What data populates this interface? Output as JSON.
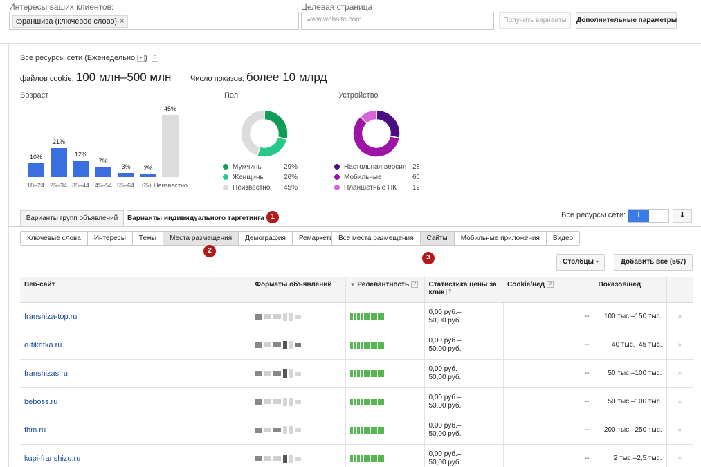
{
  "form": {
    "interests_label": "Интересы ваших клиентов:",
    "keyword_chip": "франшиза (ключевое слово)",
    "chip_remove": "×",
    "landing_label": "Целевая страница",
    "landing_placeholder": "www.website.com",
    "get_variants_btn": "Получить варианты",
    "advanced_btn": "Дополнительные параметры"
  },
  "summary": {
    "network_title": "Все ресурсы сети (Еженедельно",
    "network_title_close": ")",
    "cookies_label": "файлов cookie:",
    "cookies_value": "100 млн–500 млн",
    "impressions_label": "Число показов:",
    "impressions_value": "более 10 млрд",
    "help": "?",
    "dropdown": "▾"
  },
  "age": {
    "title": "Возраст",
    "bars": [
      {
        "label": "18–24",
        "value": "10%",
        "pct": 10
      },
      {
        "label": "25–34",
        "value": "21%",
        "pct": 21
      },
      {
        "label": "35–44",
        "value": "12%",
        "pct": 12
      },
      {
        "label": "45–54",
        "value": "7%",
        "pct": 7
      },
      {
        "label": "55–64",
        "value": "3%",
        "pct": 3
      },
      {
        "label": "65+",
        "value": "2%",
        "pct": 2
      },
      {
        "label": "Неизвестно",
        "value": "45%",
        "pct": 45
      }
    ]
  },
  "gender": {
    "title": "Пол",
    "items": [
      {
        "label": "Мужчины",
        "value": "29%",
        "color": "#0f9d58"
      },
      {
        "label": "Женщины",
        "value": "26%",
        "color": "#27c98a"
      },
      {
        "label": "Неизвестно",
        "value": "45%",
        "color": "#dcdcdc"
      }
    ]
  },
  "device": {
    "title": "Устройство",
    "items": [
      {
        "label": "Настольная версия",
        "value": "28",
        "color": "#4a0f80"
      },
      {
        "label": "Мобильные",
        "value": "60",
        "color": "#9c15a6"
      },
      {
        "label": "Планшетные ПК",
        "value": "12",
        "color": "#d665d8"
      }
    ]
  },
  "tabs": {
    "ad_groups": "Варианты групп объявлений",
    "individual": "Варианты индивидуального таргетинга",
    "badge1": "1",
    "badge2": "2",
    "badge3": "3",
    "all_network_label": "Все ресурсы сети:",
    "toggle_on": "I",
    "download_icon": "⬇"
  },
  "subtabs": [
    "Ключевые слова",
    "Интересы",
    "Темы",
    "Места размещения",
    "Демография",
    "Ремаркетинг"
  ],
  "placement_tabs": [
    "Все места размещения",
    "Сайты",
    "Мобильные приложения",
    "Видео"
  ],
  "actions": {
    "columns_btn": "Столбцы",
    "columns_caret": "▾",
    "add_all_btn": "Добавить все (567)"
  },
  "table": {
    "headers": {
      "site": "Веб-сайт",
      "formats": "Форматы объявлений",
      "relevance": "Релевантность",
      "sort_icon": "▼",
      "cpc": "Статистика цены за клик",
      "cookies": "Cookie/нед",
      "impressions": "Показов/нед"
    },
    "rows": [
      {
        "site": "franshiza-top.ru",
        "price1": "0,00 руб.–",
        "price2": "50,00 руб.",
        "cookies": "--",
        "impressions": "100 тыс.–150 тыс.",
        "chev": "»",
        "img_on": false,
        "mob_on": false,
        "vid_on": false
      },
      {
        "site": "e-tiketka.ru",
        "price1": "0,00 руб.–",
        "price2": "50,00 руб.",
        "cookies": "--",
        "impressions": "40 тыс.–45 тыс.",
        "chev": "»",
        "img_on": true,
        "mob_on": true,
        "vid_on": true
      },
      {
        "site": "franshizas.ru",
        "price1": "0,00 руб.–",
        "price2": "50,00 руб.",
        "cookies": "--",
        "impressions": "50 тыс.–100 тыс.",
        "chev": "»",
        "img_on": true,
        "mob_on": true,
        "vid_on": false
      },
      {
        "site": "beboss.ru",
        "price1": "0,00 руб.–",
        "price2": "50,00 руб.",
        "cookies": "--",
        "impressions": "50 тыс.–100 тыс.",
        "chev": "»",
        "img_on": false,
        "mob_on": false,
        "vid_on": false
      },
      {
        "site": "fbm.ru",
        "price1": "0,00 руб.–",
        "price2": "50,00 руб.",
        "cookies": "--",
        "impressions": "200 тыс.–250 тыс.",
        "chev": "»",
        "img_on": true,
        "mob_on": false,
        "vid_on": false
      },
      {
        "site": "kupi-franshizu.ru",
        "price1": "0,00 руб.–",
        "price2": "50,00 руб.",
        "cookies": "--",
        "impressions": "2 тыс.–2,5 тыс.",
        "chev": "»",
        "img_on": false,
        "mob_on": true,
        "vid_on": false
      }
    ]
  }
}
